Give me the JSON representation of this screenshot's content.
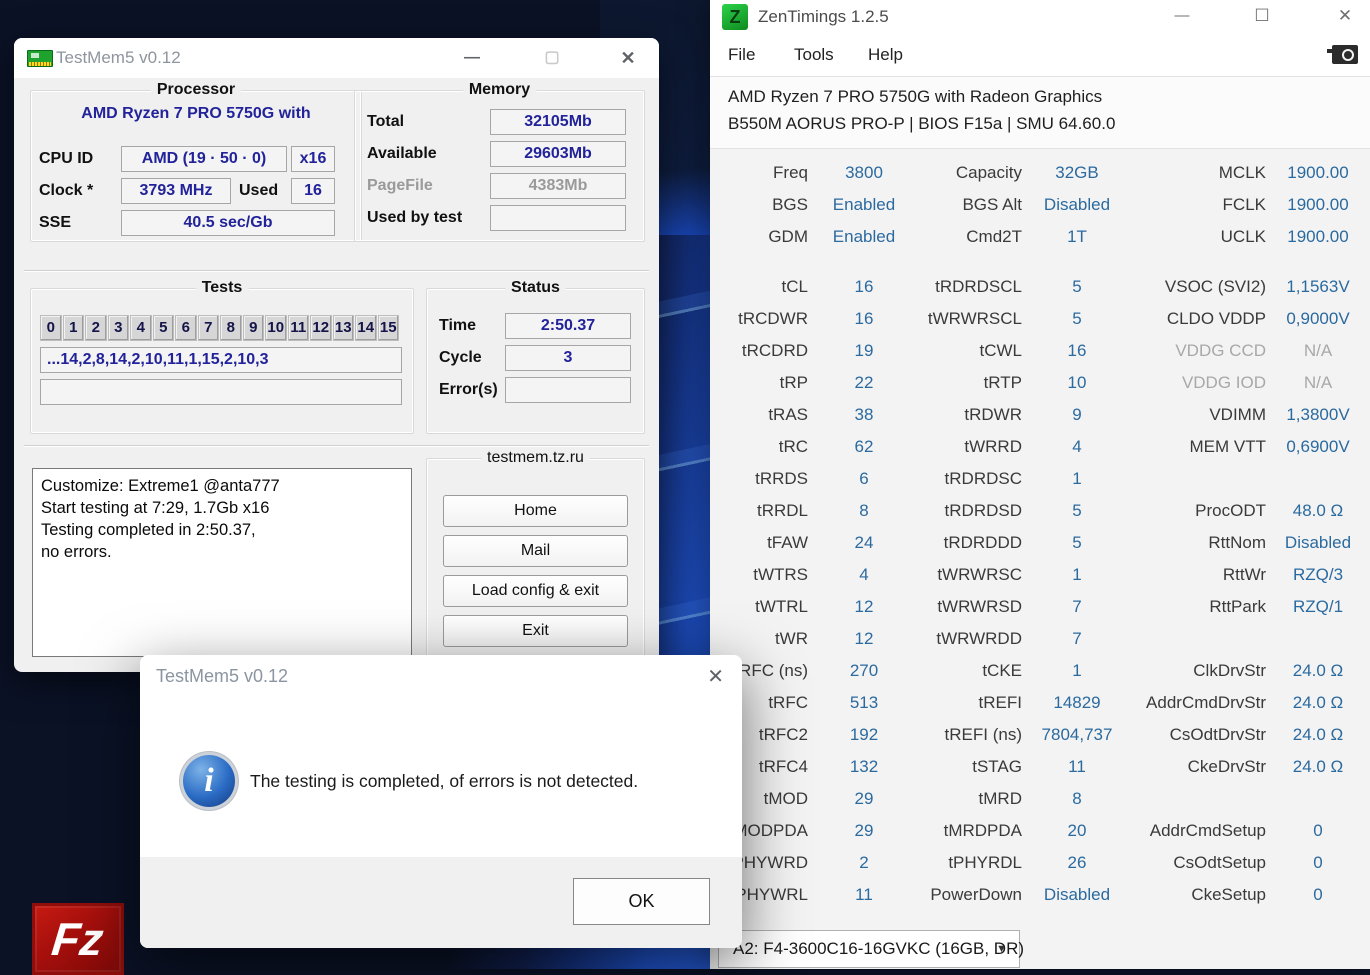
{
  "colors": {
    "value_blue": "#2b6a9f",
    "navy": "#22229a",
    "bloom_blue": "#2a63e0",
    "dialog_footer": "#f0f0f0"
  },
  "testmem": {
    "window_title": "TestMem5 v0.12",
    "titlebar": {
      "minimize": "—",
      "maximize": "▢",
      "close": "✕"
    },
    "processor": {
      "title": "Processor",
      "name_line": "AMD Ryzen 7 PRO 5750G with",
      "cpu_id_label": "CPU ID",
      "cpu_id_value": "AMD  (19 · 50 · 0)",
      "multiplier": "x16",
      "clock_label": "Clock *",
      "clock_value": "3793 MHz",
      "used_label": "Used",
      "used_value": "16",
      "sse_label": "SSE",
      "sse_value": "40.5 sec/Gb"
    },
    "memory": {
      "title": "Memory",
      "rows": [
        {
          "label": "Total",
          "value": "32105Mb"
        },
        {
          "label": "Available",
          "value": "29603Mb"
        },
        {
          "label": "PageFile",
          "value": "4383Mb"
        },
        {
          "label": "Used by test",
          "value": ""
        }
      ]
    },
    "tests": {
      "title": "Tests",
      "numbers": [
        "0",
        "1",
        "2",
        "3",
        "4",
        "5",
        "6",
        "7",
        "8",
        "9",
        "10",
        "11",
        "12",
        "13",
        "14",
        "15"
      ],
      "sequence": "...14,2,8,14,2,10,11,1,15,2,10,3",
      "extra": ""
    },
    "status": {
      "title": "Status",
      "time_label": "Time",
      "time_value": "2:50.37",
      "cycle_label": "Cycle",
      "cycle_value": "3",
      "errors_label": "Error(s)",
      "errors_value": ""
    },
    "log_lines": [
      "Customize: Extreme1 @anta777",
      "Start testing at 7:29, 1.7Gb x16",
      "Testing completed in 2:50.37,",
      "no errors."
    ],
    "site": {
      "title": "testmem.tz.ru",
      "buttons": [
        {
          "id": "home-button",
          "label": "Home"
        },
        {
          "id": "mail-button",
          "label": "Mail"
        },
        {
          "id": "load-config-exit-button",
          "label": "Load config & exit"
        },
        {
          "id": "exit-button",
          "label": "Exit"
        }
      ]
    }
  },
  "dialog": {
    "title": "TestMem5 v0.12",
    "close": "✕",
    "message": "The testing is completed, of errors is not detected.",
    "ok_label": "OK"
  },
  "zentimings": {
    "window_title": "ZenTimings 1.2.5",
    "titlebar": {
      "minimize": "—",
      "maximize": "☐",
      "close": "✕"
    },
    "menu": [
      "File",
      "Tools",
      "Help"
    ],
    "cpu_line": "AMD Ryzen 7 PRO 5750G with Radeon Graphics",
    "board_line": "B550M AORUS PRO-P | BIOS F15a | SMU 64.60.0",
    "header_rows": [
      [
        [
          "Freq",
          "3800"
        ],
        [
          "Capacity",
          "32GB"
        ],
        [
          "MCLK",
          "1900.00"
        ]
      ],
      [
        [
          "BGS",
          "Enabled"
        ],
        [
          "BGS Alt",
          "Disabled"
        ],
        [
          "FCLK",
          "1900.00"
        ]
      ],
      [
        [
          "GDM",
          "Enabled"
        ],
        [
          "Cmd2T",
          "1T"
        ],
        [
          "UCLK",
          "1900.00"
        ]
      ]
    ],
    "main_rows": [
      [
        [
          "tCL",
          "16"
        ],
        [
          "tRDRDSCL",
          "5"
        ],
        [
          "VSOC (SVI2)",
          "1,1563V"
        ]
      ],
      [
        [
          "tRCDWR",
          "16"
        ],
        [
          "tWRWRSCL",
          "5"
        ],
        [
          "CLDO VDDP",
          "0,9000V"
        ]
      ],
      [
        [
          "tRCDRD",
          "19"
        ],
        [
          "tCWL",
          "16"
        ],
        [
          "VDDG CCD",
          "N/A",
          true
        ]
      ],
      [
        [
          "tRP",
          "22"
        ],
        [
          "tRTP",
          "10"
        ],
        [
          "VDDG IOD",
          "N/A",
          true
        ]
      ],
      [
        [
          "tRAS",
          "38"
        ],
        [
          "tRDWR",
          "9"
        ],
        [
          "VDIMM",
          "1,3800V"
        ]
      ],
      [
        [
          "tRC",
          "62"
        ],
        [
          "tWRRD",
          "4"
        ],
        [
          "MEM VTT",
          "0,6900V"
        ]
      ],
      [
        [
          "tRRDS",
          "6"
        ],
        [
          "tRDRDSC",
          "1"
        ],
        [
          "",
          ""
        ]
      ],
      [
        [
          "tRRDL",
          "8"
        ],
        [
          "tRDRDSD",
          "5"
        ],
        [
          "ProcODT",
          "48.0 Ω"
        ]
      ],
      [
        [
          "tFAW",
          "24"
        ],
        [
          "tRDRDDD",
          "5"
        ],
        [
          "RttNom",
          "Disabled"
        ]
      ],
      [
        [
          "tWTRS",
          "4"
        ],
        [
          "tWRWRSC",
          "1"
        ],
        [
          "RttWr",
          "RZQ/3"
        ]
      ],
      [
        [
          "tWTRL",
          "12"
        ],
        [
          "tWRWRSD",
          "7"
        ],
        [
          "RttPark",
          "RZQ/1"
        ]
      ],
      [
        [
          "tWR",
          "12"
        ],
        [
          "tWRWRDD",
          "7"
        ],
        [
          "",
          ""
        ]
      ],
      [
        [
          "tRFC (ns)",
          "270"
        ],
        [
          "tCKE",
          "1"
        ],
        [
          "ClkDrvStr",
          "24.0 Ω"
        ]
      ],
      [
        [
          "tRFC",
          "513"
        ],
        [
          "tREFI",
          "14829"
        ],
        [
          "AddrCmdDrvStr",
          "24.0 Ω"
        ]
      ],
      [
        [
          "tRFC2",
          "192"
        ],
        [
          "tREFI (ns)",
          "7804,737"
        ],
        [
          "CsOdtDrvStr",
          "24.0 Ω"
        ]
      ],
      [
        [
          "tRFC4",
          "132"
        ],
        [
          "tSTAG",
          "11"
        ],
        [
          "CkeDrvStr",
          "24.0 Ω"
        ]
      ],
      [
        [
          "tMOD",
          "29"
        ],
        [
          "tMRD",
          "8"
        ],
        [
          "",
          ""
        ]
      ],
      [
        [
          "tMODPDA",
          "29"
        ],
        [
          "tMRDPDA",
          "20"
        ],
        [
          "AddrCmdSetup",
          "0"
        ]
      ],
      [
        [
          "tPHYWRD",
          "2"
        ],
        [
          "tPHYRDL",
          "26"
        ],
        [
          "CsOdtSetup",
          "0"
        ]
      ],
      [
        [
          "tPHYWRL",
          "11"
        ],
        [
          "PowerDown",
          "Disabled"
        ],
        [
          "CkeSetup",
          "0"
        ]
      ]
    ],
    "dimm_selector": "A2: F4-3600C16-16GVKC (16GB, DR)"
  }
}
